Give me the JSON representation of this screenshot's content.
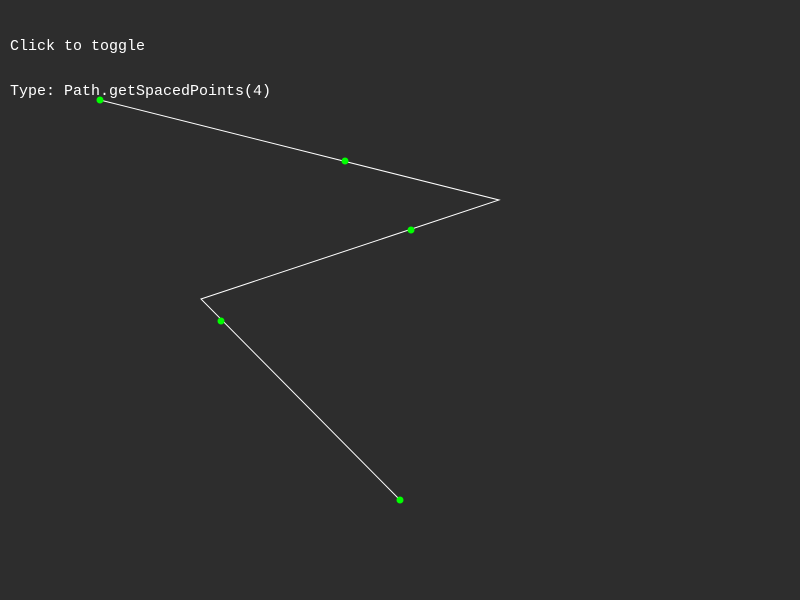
{
  "hud": {
    "hint": "Click to toggle",
    "type_line": "Type: Path.getSpacedPoints(4)"
  },
  "colors": {
    "background": "#2d2d2d",
    "path": "#ffffff",
    "point": "#00ff00",
    "text": "#ffffff"
  }
}
